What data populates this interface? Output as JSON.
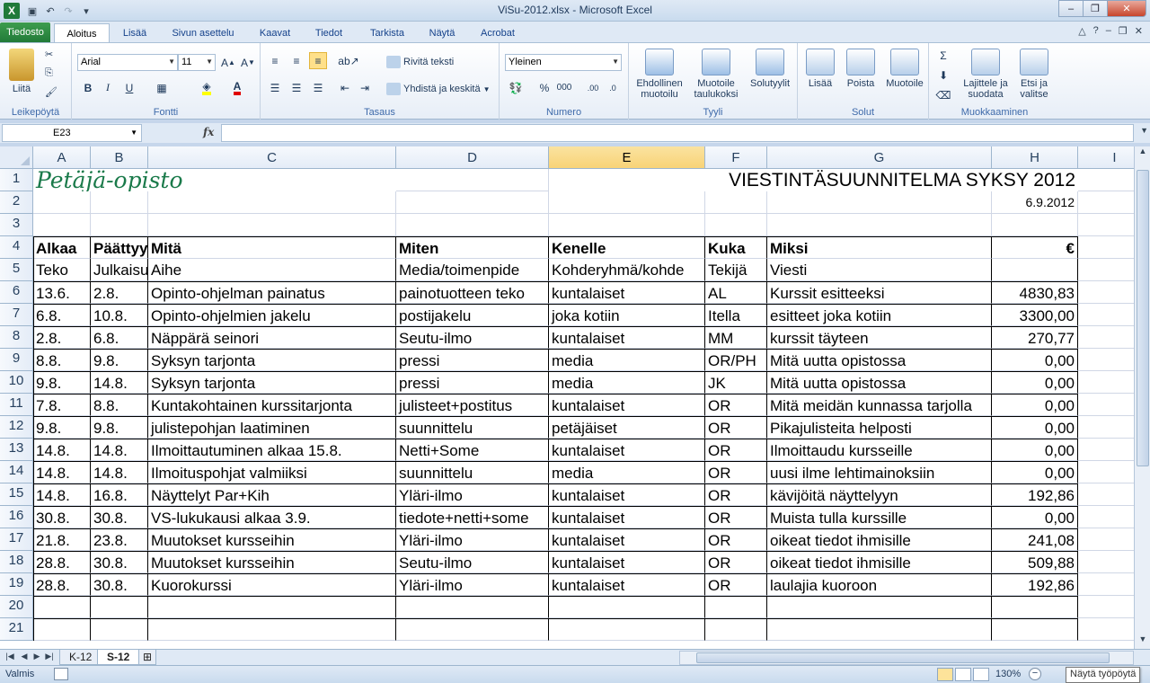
{
  "window": {
    "title": "ViSu-2012.xlsx  -  Microsoft Excel",
    "logo_letter": "X"
  },
  "ribbon_tabs": [
    "Tiedosto",
    "Aloitus",
    "Lisää",
    "Sivun asettelu",
    "Kaavat",
    "Tiedot",
    "Tarkista",
    "Näytä",
    "Acrobat"
  ],
  "ribbon": {
    "clipboard": {
      "label": "Leikepöytä",
      "paste": "Liitä"
    },
    "font": {
      "label": "Fontti",
      "family": "Arial",
      "size": "11",
      "bold": "B",
      "italic": "I",
      "underline": "U"
    },
    "alignment": {
      "label": "Tasaus",
      "wrap": "Rivitä teksti",
      "merge": "Yhdistä ja keskitä"
    },
    "number": {
      "label": "Numero",
      "format": "Yleinen",
      "percent": "%",
      "thousands": "000"
    },
    "styles": {
      "label": "Tyyli",
      "conditional": "Ehdollinen muotoilu",
      "format_table": "Muotoile taulukoksi",
      "cell_styles": "Solutyylit"
    },
    "cells": {
      "label": "Solut",
      "insert": "Lisää",
      "delete": "Poista",
      "format": "Muotoile"
    },
    "editing": {
      "label": "Muokkaaminen",
      "sort": "Lajittele ja suodata",
      "find": "Etsi ja valitse"
    }
  },
  "formula_bar": {
    "name_box": "E23",
    "fx": "fx",
    "formula": ""
  },
  "columns": [
    "A",
    "B",
    "C",
    "D",
    "E",
    "F",
    "G",
    "H",
    "I"
  ],
  "selected_column": "E",
  "sheet": {
    "brand": "Petäjä-opisto",
    "title": "VIESTINTÄSUUNNITELMA SYKSY 2012",
    "date": "6.9.2012",
    "header1": [
      "Alkaa",
      "Päättyy",
      "Mitä",
      "Miten",
      "Kenelle",
      "Kuka",
      "Miksi",
      "€"
    ],
    "header2": [
      "Teko",
      "Julkaisu",
      "Aihe",
      "Media/toimenpide",
      "Kohderyhmä/kohde",
      "Tekijä",
      "Viesti",
      ""
    ],
    "rows": [
      [
        "13.6.",
        "2.8.",
        "Opinto-ohjelman painatus",
        "painotuotteen teko",
        "kuntalaiset",
        "AL",
        "Kurssit esitteeksi",
        "4830,83"
      ],
      [
        "6.8.",
        "10.8.",
        "Opinto-ohjelmien jakelu",
        "postijakelu",
        "joka kotiin",
        "Itella",
        "esitteet joka kotiin",
        "3300,00"
      ],
      [
        "2.8.",
        "6.8.",
        "Näppärä seinori",
        "Seutu-ilmo",
        "kuntalaiset",
        "MM",
        "kurssit täyteen",
        "270,77"
      ],
      [
        "8.8.",
        "9.8.",
        "Syksyn tarjonta",
        "pressi",
        "media",
        "OR/PH",
        "Mitä uutta opistossa",
        "0,00"
      ],
      [
        "9.8.",
        "14.8.",
        "Syksyn tarjonta",
        "pressi",
        "media",
        "JK",
        "Mitä uutta opistossa",
        "0,00"
      ],
      [
        "7.8.",
        "8.8.",
        "Kuntakohtainen kurssitarjonta",
        "julisteet+postitus",
        "kuntalaiset",
        "OR",
        "Mitä meidän kunnassa tarjolla",
        "0,00"
      ],
      [
        "9.8.",
        "9.8.",
        "julistepohjan laatiminen",
        "suunnittelu",
        "petäjäiset",
        "OR",
        "Pikajulisteita  helposti",
        "0,00"
      ],
      [
        "14.8.",
        "14.8.",
        "Ilmoittautuminen alkaa 15.8.",
        "Netti+Some",
        "kuntalaiset",
        "OR",
        "Ilmoittaudu kursseille",
        "0,00"
      ],
      [
        "14.8.",
        "14.8.",
        "Ilmoituspohjat valmiiksi",
        "suunnittelu",
        "media",
        "OR",
        "uusi ilme lehtimainoksiin",
        "0,00"
      ],
      [
        "14.8.",
        "16.8.",
        "Näyttelyt Par+Kih",
        "Yläri-ilmo",
        "kuntalaiset",
        "OR",
        "kävijöitä näyttelyyn",
        "192,86"
      ],
      [
        "30.8.",
        "30.8.",
        "VS-lukukausi alkaa 3.9.",
        "tiedote+netti+some",
        "kuntalaiset",
        "OR",
        "Muista tulla kurssille",
        "0,00"
      ],
      [
        "21.8.",
        "23.8.",
        "Muutokset kursseihin",
        "Yläri-ilmo",
        "kuntalaiset",
        "OR",
        "oikeat tiedot ihmisille",
        "241,08"
      ],
      [
        "28.8.",
        "30.8.",
        "Muutokset kursseihin",
        "Seutu-ilmo",
        "kuntalaiset",
        "OR",
        "oikeat tiedot ihmisille",
        "509,88"
      ],
      [
        "28.8.",
        "30.8.",
        "Kuorokurssi",
        "Yläri-ilmo",
        "kuntalaiset",
        "OR",
        "laulajia kuoroon",
        "192,86"
      ]
    ]
  },
  "sheet_tabs": [
    "K-12",
    "S-12"
  ],
  "active_sheet": "S-12",
  "status": {
    "ready": "Valmis",
    "zoom": "130%",
    "tooltip": "Näytä työpöytä"
  }
}
